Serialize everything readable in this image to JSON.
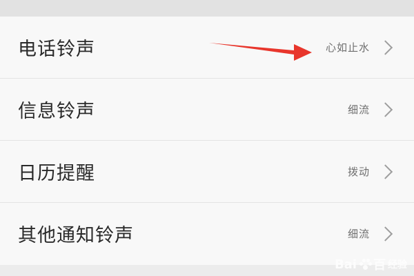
{
  "rows": [
    {
      "label": "电话铃声",
      "value": "心如止水"
    },
    {
      "label": "信息铃声",
      "value": "细流"
    },
    {
      "label": "日历提醒",
      "value": "拨动"
    },
    {
      "label": "其他通知铃声",
      "value": "细流"
    }
  ],
  "watermark": {
    "brand_left": "Bai",
    "brand_right": "百",
    "suffix": "经验"
  },
  "colors": {
    "arrow": "#e8362c",
    "background": "#f8f8f8",
    "chevron": "#9d9d9d"
  },
  "icons": {
    "chevron": "chevron-right-icon",
    "annotation": "red-arrow-icon"
  }
}
